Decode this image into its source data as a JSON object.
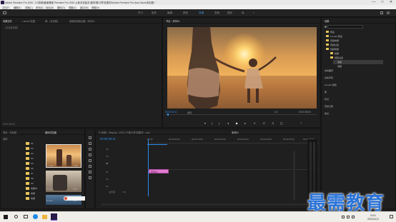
{
  "window": {
    "title": "Adobe Premiere Pro 2020 - D:\\剪辑\\最速课程 Premiere Pro 2020 从新手到高手\\素材\\第11章\\效果材\\Adobe Premiere Pro Auto-Save\\未标题 *",
    "minimize": "—",
    "maximize": "□",
    "close": "✕"
  },
  "menu": [
    "文件(F)",
    "编辑(E)",
    "剪辑(C)",
    "序列(S)",
    "标记(M)",
    "图形(G)",
    "视图(V)",
    "窗口(W)",
    "帮助(H)"
  ],
  "workspaces": {
    "items": [
      "学习",
      "组件",
      "编辑",
      "颜色",
      "效果",
      "音频",
      "图形",
      "库"
    ],
    "active_index": 4,
    "more": "»"
  },
  "source_panel": {
    "tabs": [
      "效果控件",
      "Lumetri 范围",
      "源：(无剪辑)",
      "音频剪辑混合器：序列01"
    ],
    "active_index": 0,
    "placeholder": "（未选择剪辑）",
    "timecode": "00:00:00:00"
  },
  "program_panel": {
    "title": "节目：序列01",
    "timecode": "00:00:00:11",
    "fit": "适合",
    "resolution": "1/2",
    "duration": "00:00:05:00"
  },
  "project_panel": {
    "tabs": [
      "项目：未标题",
      "媒体浏览器"
    ],
    "active_index": 1,
    "root": "素材",
    "tree": [
      "S1",
      "S2",
      "S3",
      "S4",
      "S5",
      "S6",
      "S7",
      "S8",
      "S9",
      "效果中",
      "效果",
      "效果"
    ],
    "thumbs": [
      {
        "name": "1.mp4",
        "dur": "5:00"
      },
      {
        "name": "2.mp4",
        "dur": "5:00"
      },
      {
        "name": "3.mp4",
        "dur": "4:00"
      }
    ]
  },
  "timeline": {
    "tab": "序列01",
    "path": "D:\\剪辑\\...\\ffmpeg\\...\\2020_Pr\\第11章\\效果材\\...mp4",
    "timecode": "00:00:00:11",
    "ruler": [
      "00:00",
      "00:00:05:00",
      "00:00:10:00",
      "00:00:15:00",
      "00:00:20:00",
      "00:00:25:00",
      "00:00:30:00",
      "00:00:35:00"
    ],
    "tracks": [
      "V3",
      "V2",
      "V1",
      "A1",
      "A2",
      "A3"
    ],
    "clip_label": "序列01",
    "master": "主声道",
    "master_value": "0.0"
  },
  "effects_panel": {
    "title": "效果",
    "search_placeholder": "",
    "tree": [
      "预设",
      "Lumetri 预设",
      "音频效果",
      "音频过渡",
      "视频效果",
      "模糊",
      "视频过渡",
      "溶解",
      "溶解"
    ],
    "sections": [
      "基本图形",
      "基本声音",
      "Lumetri 颜色",
      "库",
      "标记",
      "历史记录",
      "信息"
    ]
  },
  "watermark": "最需教育",
  "taskbar": {
    "time": "10:21",
    "date": "2021/11/12"
  },
  "colors": {
    "accent": "#2d8ceb",
    "clip": "#e07ad0",
    "sun": "#ffd770"
  }
}
